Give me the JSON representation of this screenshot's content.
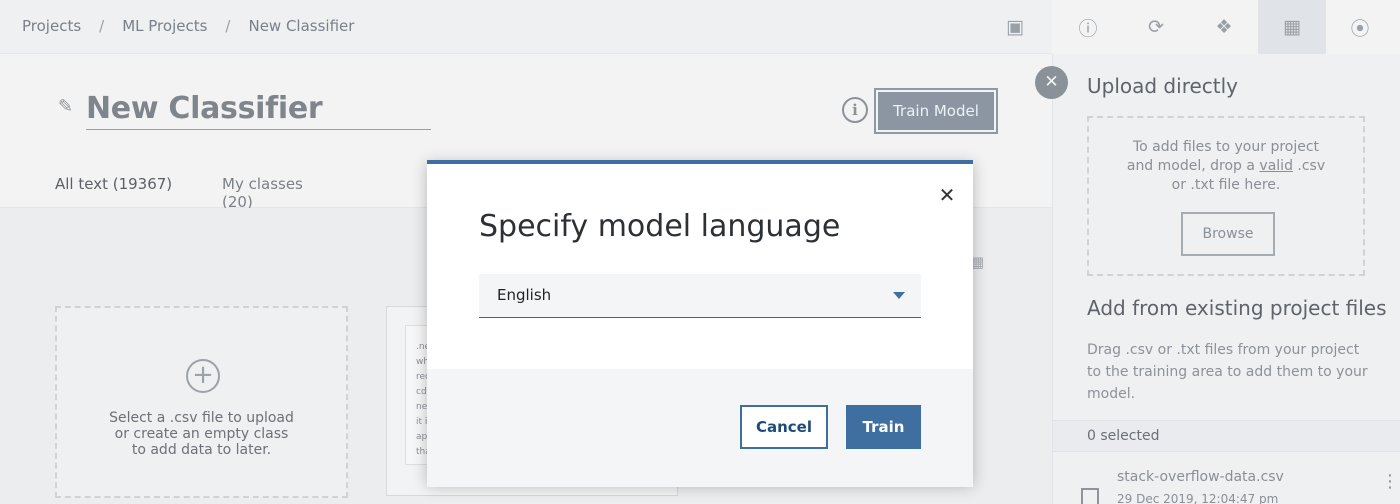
{
  "breadcrumb": [
    "Projects",
    "ML Projects",
    "New Classifier"
  ],
  "breadcrumb_sep": "/",
  "classifier": {
    "title": "New Classifier",
    "train_button": "Train Model"
  },
  "tabs": [
    {
      "label": "All text (19367)"
    },
    {
      "label": "My classes (20)"
    }
  ],
  "dropzone": {
    "line1": "Select a .csv file to upload",
    "line2": "or create an empty class",
    "line3": "to add data to later."
  },
  "preview_lines": [
    ".ne",
    "wh",
    "rec",
    "cd",
    "ne",
    "it i",
    "ap",
    "tha"
  ],
  "right_panel": {
    "upload_heading": "Upload directly",
    "upload_text_1": "To add files to your project",
    "upload_text_2a": "and model, drop a ",
    "upload_text_2b": "valid",
    "upload_text_2c": " .csv",
    "upload_text_3": "or .txt file here.",
    "browse": "Browse",
    "existing_heading": "Add from existing project files",
    "existing_text": "Drag .csv or .txt files from your project to the training area to add them to your model.",
    "selected": "0 selected",
    "file_name": "stack-overflow-data.csv",
    "file_date": "29 Dec 2019, 12:04:47 pm"
  },
  "modal": {
    "title": "Specify model language",
    "language": "English",
    "cancel": "Cancel",
    "train": "Train"
  },
  "colors": {
    "accent": "#3f6fa1",
    "overlay_bg": "#f3f3f3"
  }
}
